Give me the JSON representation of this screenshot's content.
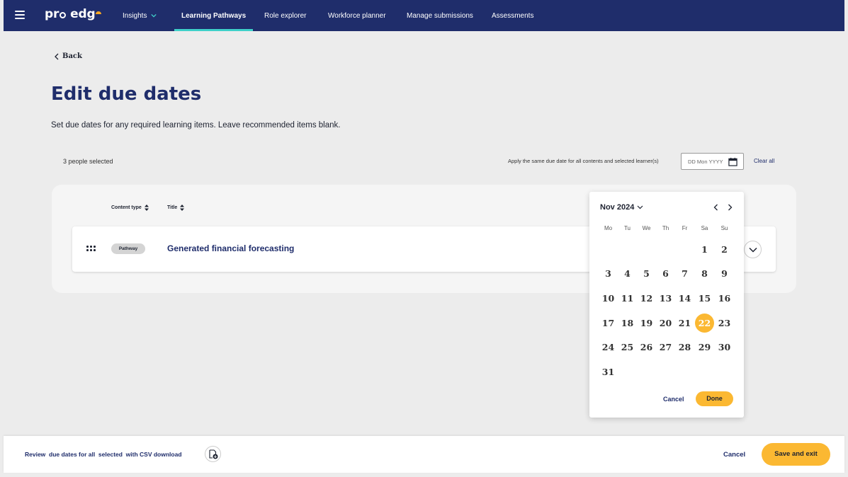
{
  "nav": {
    "logo_text_left": "pr",
    "logo_text_right": "edg",
    "items": [
      {
        "label": "Insights"
      },
      {
        "label": "Learning Pathways"
      },
      {
        "label": "Role explorer"
      },
      {
        "label": "Workforce planner"
      },
      {
        "label": "Manage submissions"
      },
      {
        "label": "Assessments"
      }
    ],
    "active_index": 1,
    "accent_color": "#3fd0c9",
    "background_color": "#1f2d6b"
  },
  "page": {
    "back_label": "Back",
    "title": "Edit due dates",
    "subtitle": "Set due dates for any required learning items. Leave recommended items blank."
  },
  "toolbar": {
    "people_selected": "3 people selected",
    "apply_label": "Apply the same due date for all contents and selected learner(s)",
    "date_placeholder": "DD Mon YYYY",
    "clear_all": "Clear all"
  },
  "table": {
    "columns": [
      "Content type",
      "Title"
    ],
    "rows": [
      {
        "content_type": "Pathway",
        "title": "Generated financial forecasting"
      }
    ]
  },
  "calendar": {
    "month_label": "Nov 2024",
    "weekdays": [
      "Mo",
      "Tu",
      "We",
      "Th",
      "Fr",
      "Sa",
      "Su"
    ],
    "first_weekday_index": 5,
    "days_in_month": 31,
    "selected_day": 22,
    "cancel_label": "Cancel",
    "done_label": "Done",
    "highlight_color": "#fbb832"
  },
  "footer": {
    "review_text": "Review  due dates for all  selected  with CSV download",
    "cancel_label": "Cancel",
    "save_label": "Save and exit"
  }
}
